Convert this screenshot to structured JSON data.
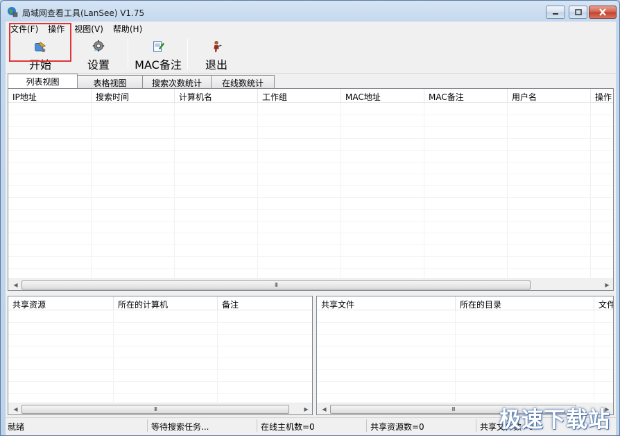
{
  "window": {
    "title": "局域网查看工具(LanSee) V1.75"
  },
  "menu": [
    "文件(F)",
    "操作",
    "视图(V)",
    "帮助(H)"
  ],
  "toolbar": [
    {
      "label": "开始",
      "icon": "start-icon"
    },
    {
      "label": "设置",
      "icon": "settings-gear-icon"
    },
    {
      "label": "MAC备注",
      "icon": "mac-note-icon"
    },
    {
      "label": "退出",
      "icon": "exit-icon"
    }
  ],
  "tabs": [
    "列表视图",
    "表格视图",
    "搜索次数统计",
    "在线数统计"
  ],
  "main_table": {
    "columns": [
      "IP地址",
      "搜索时间",
      "计算机名",
      "工作组",
      "MAC地址",
      "MAC备注",
      "用户名",
      "操作"
    ]
  },
  "shares_table": {
    "columns": [
      "共享资源",
      "所在的计算机",
      "备注"
    ]
  },
  "files_table": {
    "columns": [
      "共享文件",
      "所在的目录",
      "文件"
    ]
  },
  "scroll_grip": "III",
  "status": {
    "ready": "就绪",
    "waiting": "等待搜索任务...",
    "online_hosts": "在线主机数=0",
    "shared_resources": "共享资源数=0",
    "shared_files": "共享文件数=0"
  },
  "watermark": "极速下载站",
  "colors": {
    "highlight": "#e03535",
    "title_bar": "#c4d8ee"
  }
}
